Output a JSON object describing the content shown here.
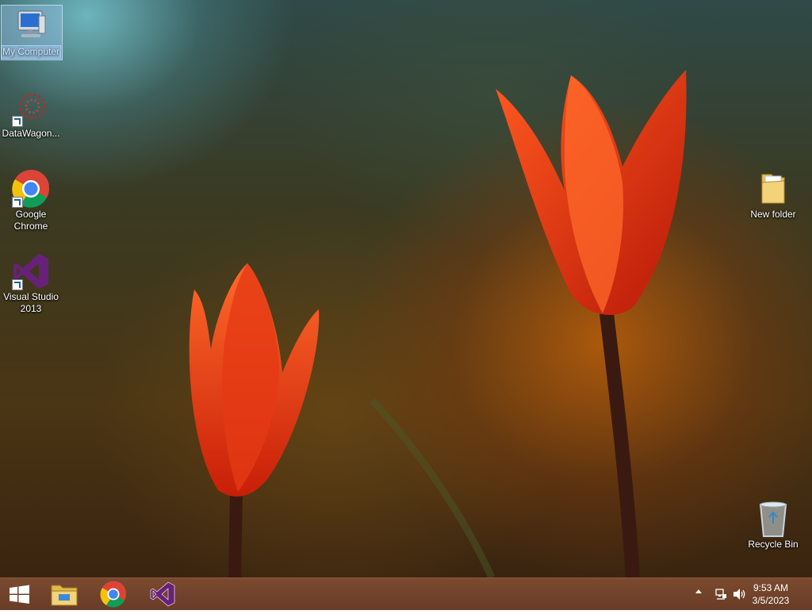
{
  "desktop_icons": {
    "my_computer": "My Computer",
    "datawagon": "DataWagon...",
    "google_chrome": "Google Chrome",
    "visual_studio": "Visual Studio 2013",
    "new_folder": "New folder",
    "recycle_bin": "Recycle Bin"
  },
  "taskbar": {
    "pinned": [
      "start-button",
      "file-explorer",
      "google-chrome",
      "visual-studio"
    ],
    "clock_time": "9:53 AM",
    "clock_date": "3/5/2023"
  },
  "colors": {
    "taskbar": "#6e4029",
    "chrome_red": "#db4437",
    "chrome_yellow": "#f4c20d",
    "chrome_green": "#0f9d58",
    "chrome_blue": "#4285f4",
    "vs_purple": "#68217a"
  }
}
